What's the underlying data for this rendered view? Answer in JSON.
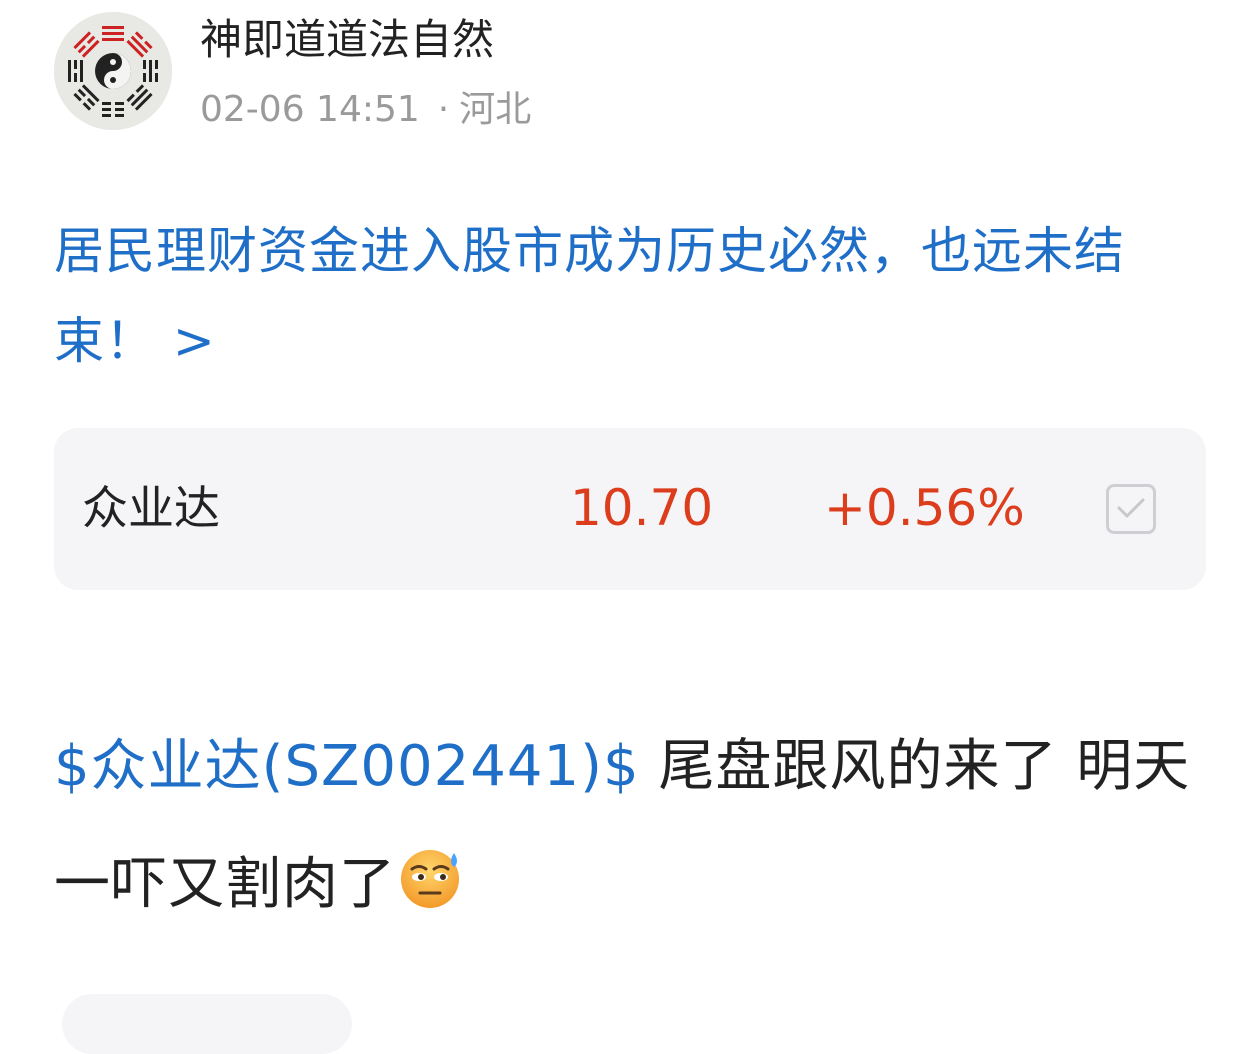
{
  "post": {
    "author": {
      "name": "神即道道法自然",
      "avatar_icon": "bagua-taiji-avatar"
    },
    "time": "02-06 14:51",
    "separator": "·",
    "location": "河北",
    "topic_link": {
      "text": "居民理财资金进入股市成为历史必然，也远未结束！ >",
      "color": "#1f6fc9"
    },
    "stock_card": {
      "name": "众业达",
      "price": "10.70",
      "change": "+0.56%",
      "change_color": "#dc3d1c",
      "checkbox_icon": "check-icon"
    },
    "content": {
      "cashtag": "$众业达(SZ002441)$",
      "text": " 尾盘跟风的来了 明天一吓又割肉了",
      "emoji": "sweat-smile-emoji"
    }
  }
}
